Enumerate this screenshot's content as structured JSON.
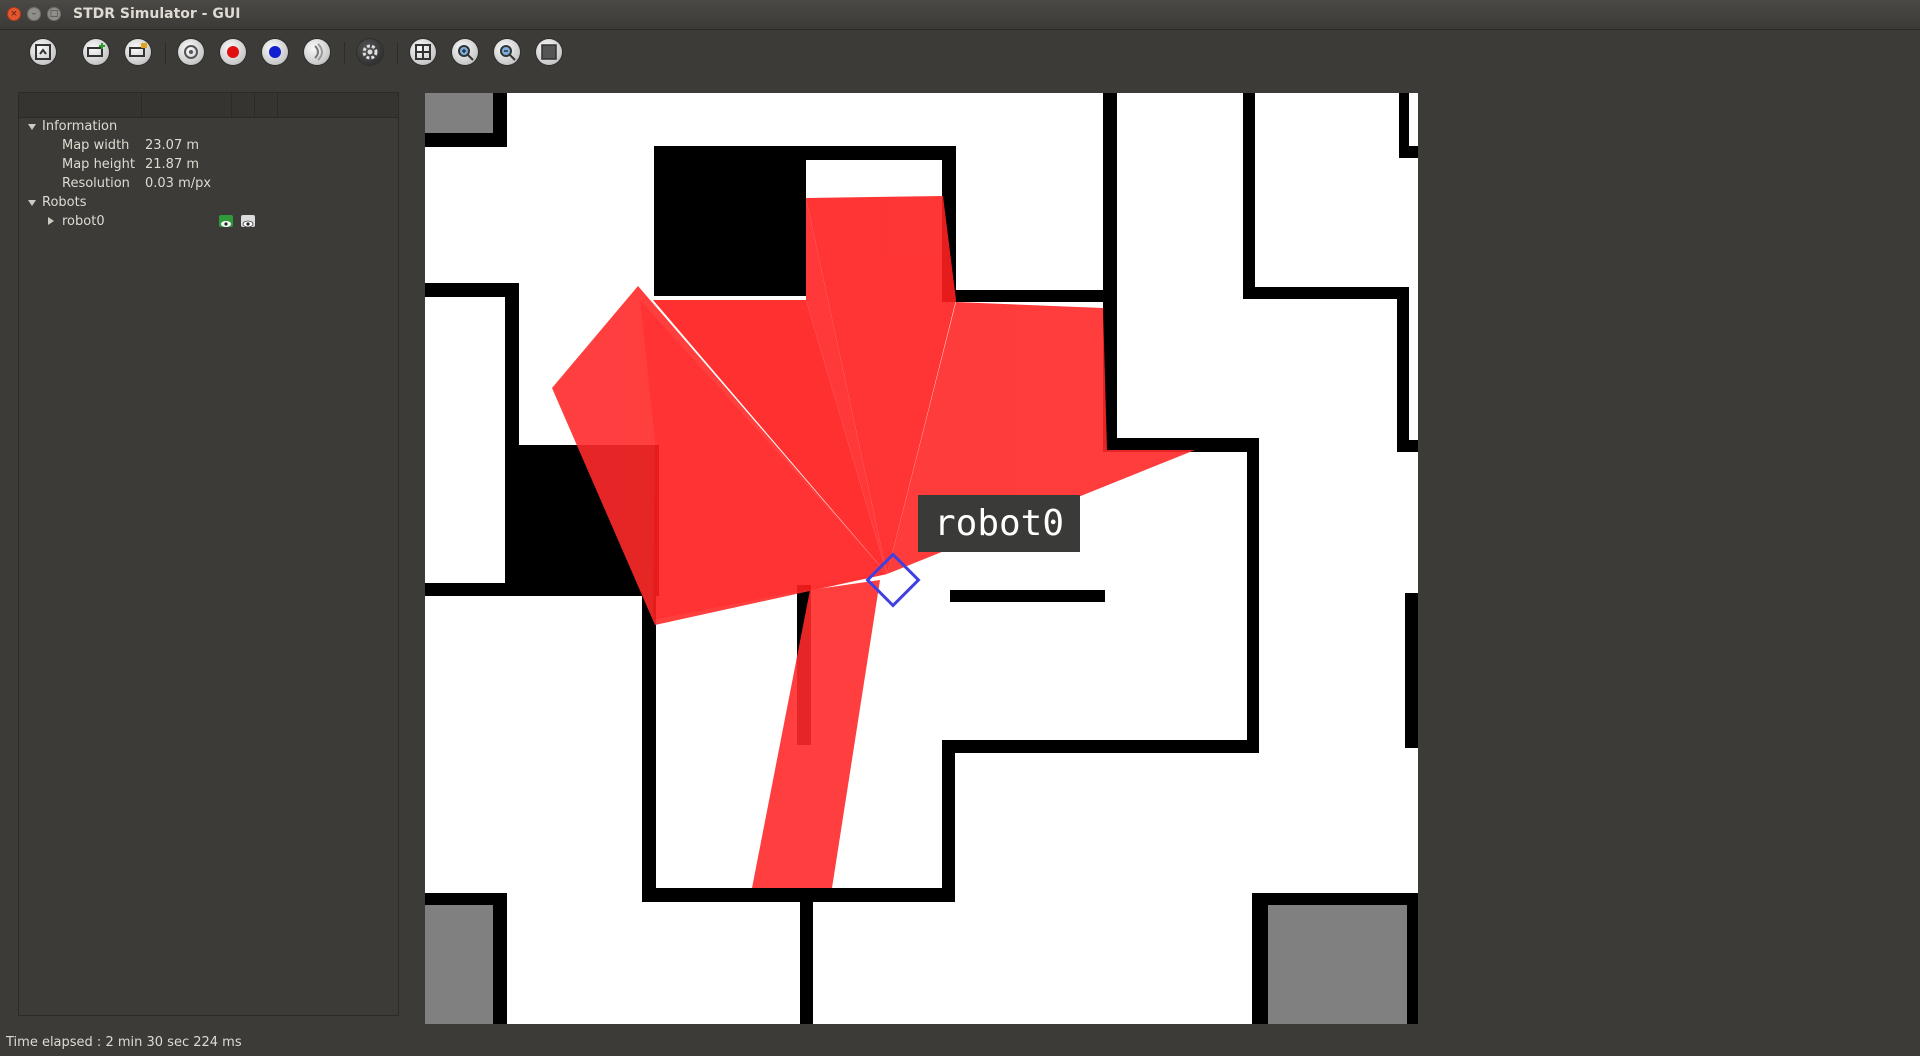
{
  "window": {
    "title": "STDR Simulator - GUI"
  },
  "toolbar": {
    "buttons": [
      {
        "name": "load-map-button",
        "icon": "map-load-icon"
      },
      {
        "name": "add-robot-button",
        "icon": "robot-add-icon"
      },
      {
        "name": "load-robot-button",
        "icon": "robot-load-icon"
      },
      {
        "name": "properties-button",
        "icon": "gear-badge-icon"
      },
      {
        "name": "record-red-button",
        "icon": "red-dot-icon"
      },
      {
        "name": "record-blue-button",
        "icon": "blue-dot-icon"
      },
      {
        "name": "sonar-button",
        "icon": "sonar-wave-icon"
      },
      {
        "name": "settings-button",
        "icon": "gear-icon"
      },
      {
        "name": "grid-button",
        "icon": "grid-icon"
      },
      {
        "name": "zoom-in-button",
        "icon": "zoom-in-icon"
      },
      {
        "name": "zoom-out-button",
        "icon": "zoom-out-icon"
      },
      {
        "name": "fit-view-button",
        "icon": "fit-square-icon"
      }
    ]
  },
  "tree": {
    "information": {
      "label": "Information",
      "rows": [
        {
          "key": "Map width",
          "value": "23.07 m"
        },
        {
          "key": "Map height",
          "value": "21.87 m"
        },
        {
          "key": "Resolution",
          "value": "0.03 m/px"
        }
      ]
    },
    "robots": {
      "label": "Robots",
      "items": [
        {
          "label": "robot0"
        }
      ]
    }
  },
  "map": {
    "robot_label": "robot0",
    "colors": {
      "laser": "#ff2020",
      "robot": "#4040e0",
      "wall": "#000000",
      "unknown": "#808080"
    }
  },
  "status": {
    "text": "Time elapsed : 2 min 30 sec 224 ms"
  }
}
